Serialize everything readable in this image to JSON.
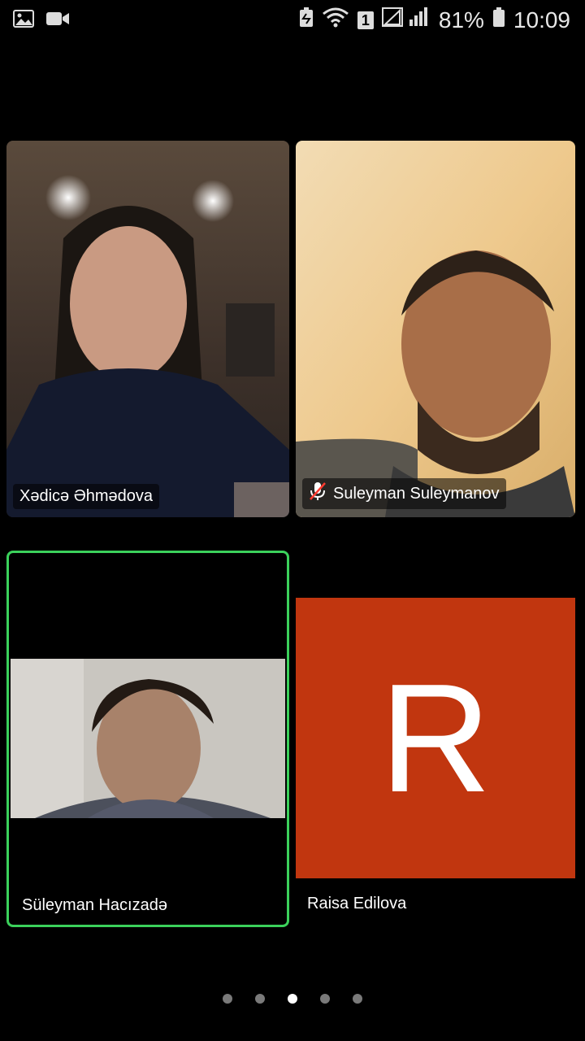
{
  "status_bar": {
    "battery_percent": "81%",
    "time": "10:09",
    "sim_badge": "1",
    "icons": [
      "image-icon",
      "video-icon",
      "battery-saver-icon",
      "wifi-icon",
      "signal-icon",
      "battery-icon"
    ]
  },
  "participants": [
    {
      "name": "Xədicə Əhmədova",
      "muted": false,
      "active_speaker": false
    },
    {
      "name": "Suleyman Suleymanov",
      "muted": true,
      "active_speaker": false
    },
    {
      "name": "Süleyman Hacızadə",
      "muted": false,
      "active_speaker": true
    },
    {
      "name": "Raisa Edilova",
      "muted": false,
      "active_speaker": false,
      "avatar_letter": "R",
      "avatar_color": "#c1360f"
    }
  ],
  "pager": {
    "total": 5,
    "active_index": 2
  },
  "colors": {
    "active_speaker_border": "#3bd15b",
    "background": "#000000"
  }
}
